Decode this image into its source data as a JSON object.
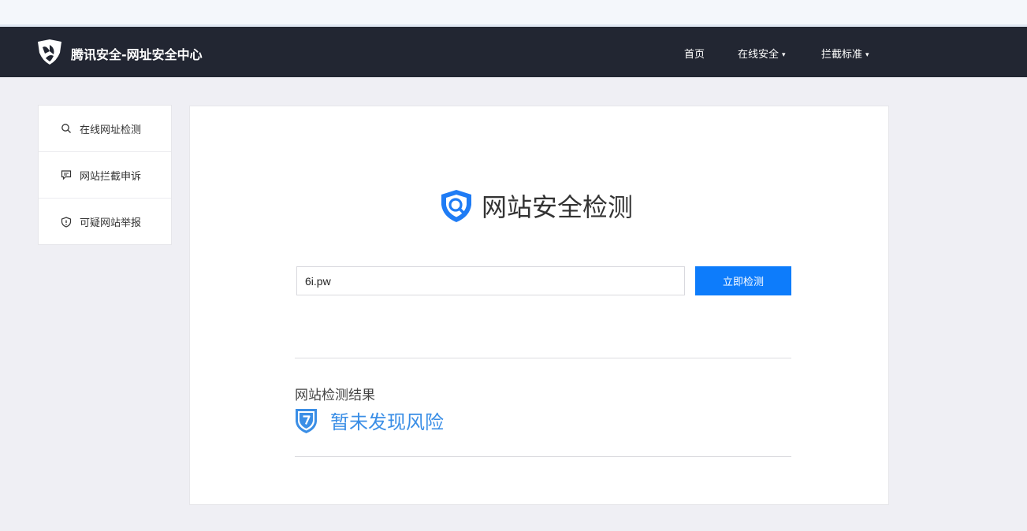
{
  "header": {
    "brand": "腾讯安全-网址安全中心",
    "nav": [
      {
        "label": "首页",
        "has_dropdown": false
      },
      {
        "label": "在线安全",
        "has_dropdown": true
      },
      {
        "label": "拦截标准",
        "has_dropdown": true
      }
    ],
    "caret": "▾"
  },
  "sidebar": {
    "items": [
      {
        "label": "在线网址检测",
        "icon": "search-icon"
      },
      {
        "label": "网站拦截申诉",
        "icon": "chat-icon"
      },
      {
        "label": "可疑网站举报",
        "icon": "shield-alert-icon"
      }
    ]
  },
  "main": {
    "title": "网站安全检测",
    "url_value": "6i.pw",
    "check_button": "立即检测",
    "result_heading": "网站检测结果",
    "result_status": "暂未发现风险"
  },
  "colors": {
    "navbar": "#222632",
    "primary": "#0d7cfb",
    "result_text": "#3a8ee6",
    "background": "#efeff4"
  }
}
